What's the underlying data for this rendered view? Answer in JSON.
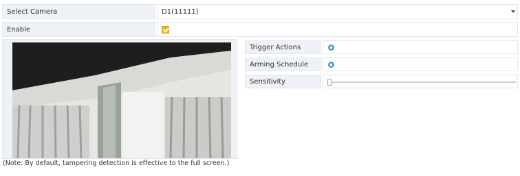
{
  "camera": {
    "label": "Select Camera",
    "value": "D1(11111)"
  },
  "enable": {
    "label": "Enable",
    "checked": true
  },
  "preview": {
    "osd_time": "",
    "osd_name": "",
    "note": "(Note: By default, tampering detection is effective to the full screen.)"
  },
  "settings": {
    "trigger_actions": {
      "label": "Trigger Actions",
      "icon": "gear-icon"
    },
    "arming_schedule": {
      "label": "Arming Schedule",
      "icon": "gear-icon"
    },
    "sensitivity": {
      "label": "Sensitivity",
      "level": 0.0
    }
  },
  "colors": {
    "accent": "#f3b51b",
    "gear": "#4a9fc6",
    "label_bg": "#eef1f5",
    "osd_text": "#b8282e"
  }
}
